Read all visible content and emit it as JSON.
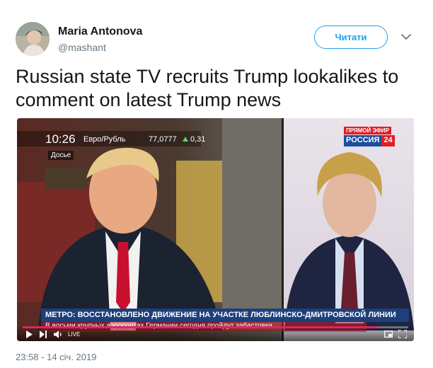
{
  "user": {
    "name": "Maria Antonova",
    "handle": "@mashant"
  },
  "follow_button": {
    "label": "Читати"
  },
  "tweet": {
    "text": "Russian state TV recruits Trump lookalikes to comment on latest Trump news",
    "timestamp": "23:58 - 14 січ. 2019"
  },
  "video": {
    "clock": "10:26",
    "currency_label": "Евро/Рубль",
    "currency_value": "77,0777",
    "currency_change": "0,31",
    "dossier_label": "Досье",
    "live_label": "ПРЯМОЙ ЭФИР",
    "channel": "РОССИЯ",
    "channel_number": "24",
    "ticker_main": "МЕТРО: ВОССТАНОВЛЕНО ДВИЖЕНИЕ НА УЧАСТКЕ ЛЮБЛИНСКО-ДМИТРОВСКОЙ ЛИНИИ",
    "ticker_sub": "В восьми крупных аэропортах Германии сегодня пройдут забастовки",
    "live_badge": "LIVE",
    "progress": 0.92,
    "colors": {
      "channel_red": "#e21d24",
      "channel_blue": "#1a4fa0",
      "ticker_bg": "#1d3f7c",
      "progress_red": "#e0245e"
    }
  }
}
